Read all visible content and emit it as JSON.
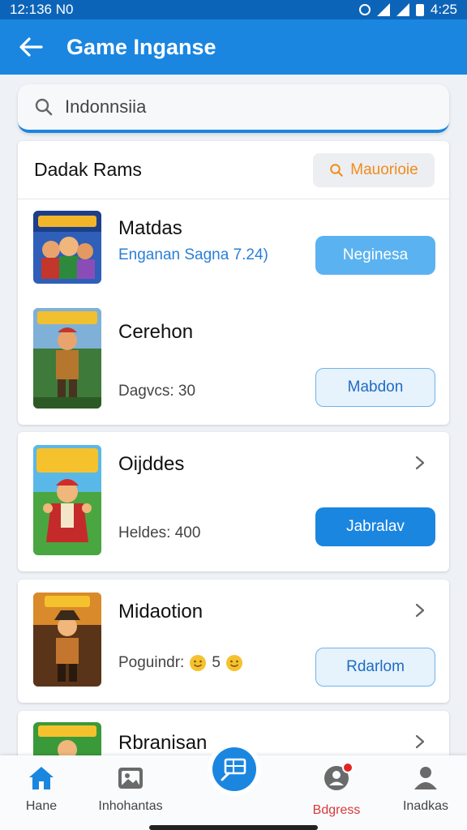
{
  "status_bar": {
    "time": "12:136 N0",
    "right": "4:25"
  },
  "app_bar": {
    "title": "Game Inganse"
  },
  "search": {
    "value": "Indonnsiia"
  },
  "card1": {
    "title": "Dadak Rams",
    "more_label": "Mauorioie",
    "games": [
      {
        "name": "Matdas",
        "sub": "Enganan Sagna 7.24)",
        "button": "Neginesa"
      },
      {
        "name": "Cerehon",
        "sub": "Dagvcs: 30",
        "button": "Mabdon"
      }
    ]
  },
  "card2": {
    "name": "Oijddes",
    "sub": "Heldes: 400",
    "button": "Jabralav"
  },
  "card3": {
    "name": "Midaotion",
    "sub_prefix": "Poguindr:",
    "sub_value": "5",
    "button": "Rdarlom"
  },
  "card4": {
    "name": "Rbranisan"
  },
  "bottom_nav": [
    {
      "label": "Hane",
      "icon": "home-icon"
    },
    {
      "label": "Inhohantas",
      "icon": "gallery-icon"
    },
    {
      "label": "",
      "icon": "center-action-icon"
    },
    {
      "label": "Bdgress",
      "icon": "notification-user-icon"
    },
    {
      "label": "Inadkas",
      "icon": "profile-icon"
    }
  ],
  "colors": {
    "primary": "#1a86e0",
    "status": "#0c64b8",
    "accent_orange": "#f08c1a",
    "badge_red": "#e02424"
  }
}
